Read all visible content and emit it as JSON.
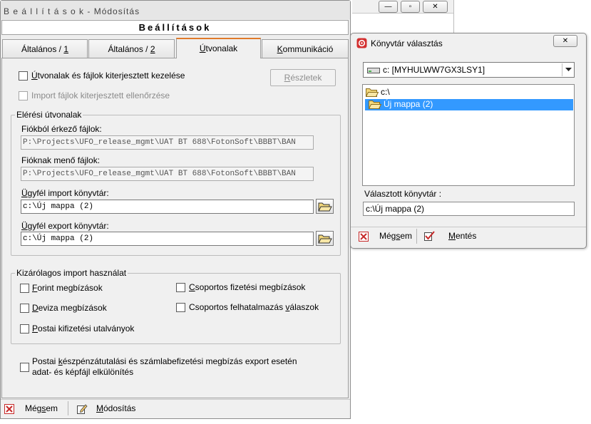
{
  "colors": {
    "accent_tab": "#e07a2a",
    "selection": "#3399ff",
    "cancel_red": "#c62828",
    "folder_yellow": "#f2d77a"
  },
  "background_window": {
    "minimize": "—",
    "restore": "▫",
    "close": "✕"
  },
  "main_window": {
    "title": "B e á l l í t á s o k - Módosítás",
    "header": "Beállítások",
    "tabs": [
      {
        "prefix": "Általános / ",
        "hotkey": "1",
        "suffix": ""
      },
      {
        "prefix": "Általános / ",
        "hotkey": "2",
        "suffix": ""
      },
      {
        "prefix": "",
        "hotkey": "Ú",
        "suffix": "tvonalak"
      },
      {
        "prefix": "",
        "hotkey": "K",
        "suffix": "ommunikáció"
      }
    ],
    "active_tab": "Útvonalak",
    "extended_paths": {
      "hotkey": "Ú",
      "rest": "tvonalak és fájlok kiterjesztett kezelése",
      "checked": false
    },
    "import_ext_check": {
      "label": "Import fájlok kiterjesztett ellenőrzése",
      "enabled": false
    },
    "details_button": {
      "hotkey": "R",
      "rest": "észletek"
    },
    "paths_group": {
      "legend": "Elérési útvonalak",
      "incoming_label": "Fiókból érkező fájlok:",
      "incoming_value": "P:\\Projects\\UFO_release_mgmt\\UAT BT 688\\FotonSoft\\BBBT\\BAN",
      "outgoing_label": "Fióknak menő fájlok:",
      "outgoing_value": "P:\\Projects\\UFO_release_mgmt\\UAT BT 688\\FotonSoft\\BBBT\\BAN",
      "client_import": {
        "hotkey": "Ü",
        "rest": "gyfél import könyvtár:",
        "value": "c:\\Új mappa (2)"
      },
      "client_export": {
        "hotkey": "Ü",
        "rest": "gyfél export könyvtár:",
        "value": "c:\\Új mappa (2)"
      }
    },
    "exclusive_group": {
      "legend": "Kizárólagos import használat",
      "forint": {
        "hotkey": "F",
        "rest": "orint megbízások",
        "checked": false
      },
      "deviza": {
        "hotkey": "D",
        "rest": "eviza megbízások",
        "checked": false
      },
      "postai": {
        "hotkey": "P",
        "rest": "ostai kifizetési utalványok",
        "checked": false
      },
      "csop_fizetesi": {
        "hotkey": "C",
        "rest": "soportos fizetési megbízások",
        "checked": false
      },
      "csop_felhatalmazas": {
        "pre": "Csoportos felhatalmazás ",
        "hotkey": "v",
        "rest": "álaszok",
        "checked": false
      }
    },
    "postal_split": {
      "pre": "Postai ",
      "hotkey": "k",
      "line1_rest": "észpénzátutalási és számlabefizetési megbízás export esetén",
      "line2": "adat- és képfájl elkülönítés",
      "checked": false
    },
    "footer": {
      "cancel": {
        "pre": "Még",
        "hotkey": "s",
        "rest": "em"
      },
      "modify": {
        "hotkey": "M",
        "rest": "ódosítás"
      }
    }
  },
  "dialog": {
    "title": "Könyvtár választás",
    "close_glyph": "✕",
    "drive": "c: [MYHULWW7GX3LSY1]",
    "tree": [
      {
        "label": "c:\\",
        "selected": false
      },
      {
        "label": "Új mappa (2)",
        "selected": true
      }
    ],
    "selected_label": "Választott könyvtár :",
    "selected_value": "c:\\Új mappa (2)",
    "cancel": {
      "pre": "Még",
      "hotkey": "s",
      "rest": "em"
    },
    "save": {
      "pre": "",
      "hotkey": "M",
      "rest": "entés"
    }
  }
}
